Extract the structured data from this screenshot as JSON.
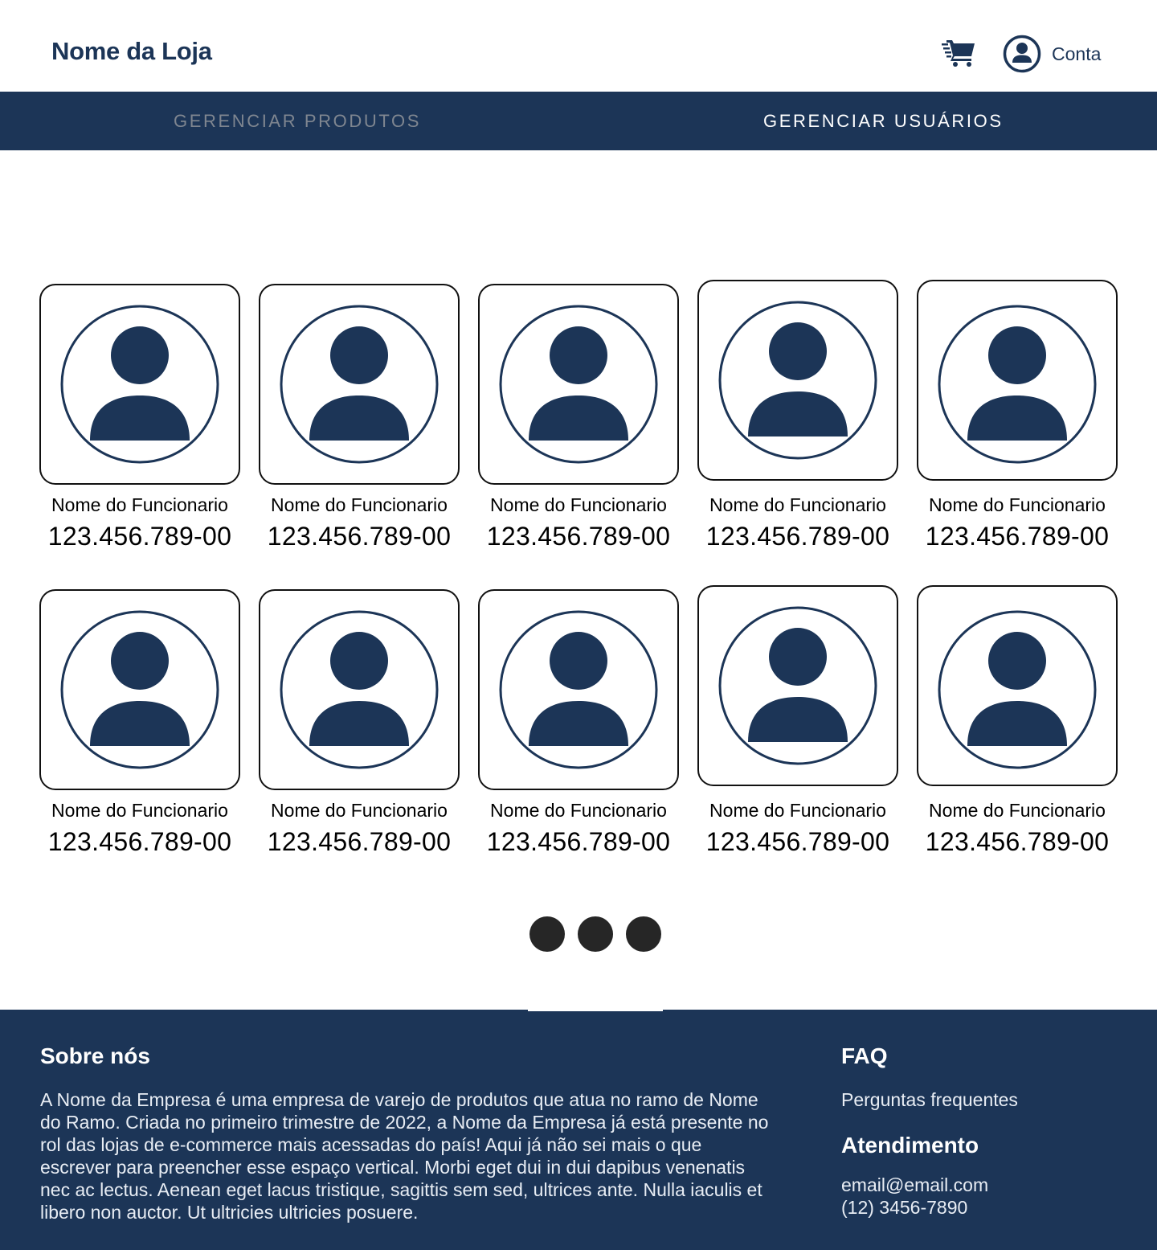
{
  "header": {
    "brand": "Nome da Loja",
    "cart_icon": "cart-icon",
    "account_icon": "user-circle-icon",
    "account_label": "Conta"
  },
  "nav": {
    "tabs": [
      {
        "label": "GERENCIAR PRODUTOS",
        "active": false
      },
      {
        "label": "GERENCIAR USUÁRIOS",
        "active": true
      }
    ]
  },
  "employees": [
    {
      "name": "Nome do Funcionario",
      "id": "123.456.789-00"
    },
    {
      "name": "Nome do Funcionario",
      "id": "123.456.789-00"
    },
    {
      "name": "Nome do Funcionario",
      "id": "123.456.789-00"
    },
    {
      "name": "Nome do Funcionario",
      "id": "123.456.789-00"
    },
    {
      "name": "Nome do Funcionario",
      "id": "123.456.789-00"
    },
    {
      "name": "Nome do Funcionario",
      "id": "123.456.789-00"
    },
    {
      "name": "Nome do Funcionario",
      "id": "123.456.789-00"
    },
    {
      "name": "Nome do Funcionario",
      "id": "123.456.789-00"
    },
    {
      "name": "Nome do Funcionario",
      "id": "123.456.789-00"
    },
    {
      "name": "Nome do Funcionario",
      "id": "123.456.789-00"
    }
  ],
  "pagination": {
    "dot_count": 3
  },
  "footer": {
    "about_title": "Sobre nós",
    "about_lines": [
      "A Nome da Empresa é uma empresa de varejo de produtos que atua no ramo de Nome",
      "do Ramo. Criada no primeiro trimestre de 2022, a Nome da Empresa já está presente no",
      "rol das  lojas de e-commerce mais acessadas do país! Aqui já não sei mais o que",
      "escrever para preencher esse espaço vertical. Morbi eget dui in dui dapibus venenatis",
      "nec ac lectus. Aenean eget lacus tristique, sagittis sem sed, ultrices ante. Nulla iaculis et",
      "libero non auctor. Ut ultricies ultricies posuere."
    ],
    "faq_title": "FAQ",
    "faq_link": "Perguntas frequentes",
    "attendance_title": "Atendimento",
    "email": "email@email.com",
    "phone": "(12) 3456-7890"
  },
  "colors": {
    "primary": "#1c3557",
    "nav_inactive": "#7f8690",
    "dot": "#262626"
  }
}
